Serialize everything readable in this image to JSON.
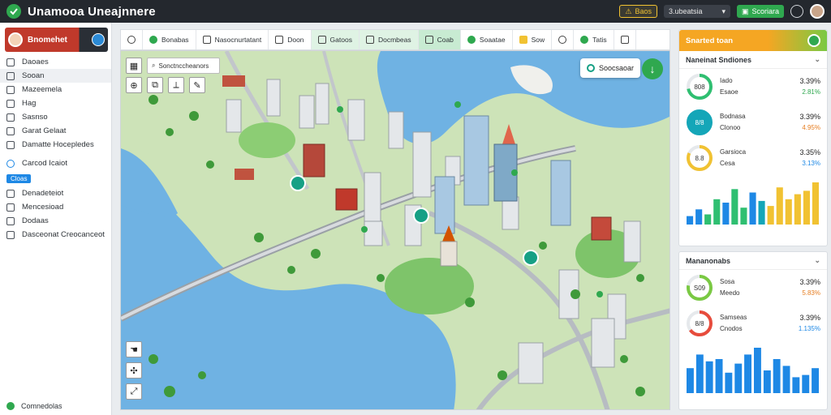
{
  "titlebar": {
    "app_title": "Unamooa Uneajnnere",
    "warn_chip": "Baos",
    "dropdown_label": "3.ubeatsia",
    "action_label": "Scoriara"
  },
  "sidebar": {
    "header_label": "Bnomehet",
    "items": [
      {
        "label": "Daoaes",
        "icon": "folder-icon"
      },
      {
        "label": "Sooan",
        "icon": "layers-icon",
        "active": true
      },
      {
        "label": "Mazeemela",
        "icon": "mail-icon"
      },
      {
        "label": "Hag",
        "icon": "map-icon"
      },
      {
        "label": "Sasnso",
        "icon": "list-icon"
      },
      {
        "label": "Garat Gelaat",
        "icon": "chart-icon"
      },
      {
        "label": "Damatte Hocepledes",
        "icon": "calendar-icon"
      }
    ],
    "section_item": {
      "label": "Carcod Icaiot",
      "icon": "target-icon"
    },
    "tag_label": "Cloas",
    "items2": [
      {
        "label": "Denadeteiot",
        "icon": "document-icon"
      },
      {
        "label": "Mencesioad",
        "icon": "message-icon"
      },
      {
        "label": "Dodaas",
        "icon": "grid-icon"
      },
      {
        "label": "Dasceonat Creocanceot",
        "icon": "settings-icon"
      }
    ],
    "footer_label": "Comnedolas"
  },
  "tabs": [
    {
      "label": "Bonabas",
      "icon": "globe-icon"
    },
    {
      "label": "Nasocnurtatant",
      "icon": "nodes-icon"
    },
    {
      "label": "Doon",
      "icon": "image-icon"
    },
    {
      "label": "Gatoos",
      "icon": "pin-icon",
      "hl": true
    },
    {
      "label": "Docmbeas",
      "icon": "route-icon",
      "hl": true
    },
    {
      "label": "Coab",
      "icon": "layers-icon",
      "hl2": true
    },
    {
      "label": "Soaatae",
      "icon": "circle-icon"
    },
    {
      "label": "Sow",
      "icon": "star-icon"
    },
    {
      "label": "",
      "icon": "shield-icon"
    },
    {
      "label": "Tatis",
      "icon": "leaf-icon"
    },
    {
      "label": "",
      "icon": "box-icon"
    }
  ],
  "map": {
    "search_text": "Sonctnccheanors",
    "pill_label": "Soocsaoar"
  },
  "rpanel": {
    "header_label": "Snarted toan",
    "card1": {
      "title": "Naneinat Sndiones",
      "metrics": [
        {
          "ring_label": "808",
          "name": "Iado",
          "sub": "Esaoe",
          "value": "3.39%",
          "delta": "2.81%",
          "ring_color": "#2fbf71",
          "ring_pct": 72,
          "delta_color": "up"
        },
        {
          "ring_label": "8/8",
          "name": "Bodnasa",
          "sub": "Clonoo",
          "value": "3.39%",
          "delta": "4.95%",
          "ring_color": "#14a6b8",
          "ring_pct": 100,
          "delta_color": "neg"
        },
        {
          "ring_label": "8.8",
          "name": "Garsioca",
          "sub": "Cesa",
          "value": "3.35%",
          "delta": "3.13%",
          "ring_color": "#f1c232",
          "ring_pct": 82,
          "delta_color": "blue"
        }
      ],
      "bar_values": [
        10,
        18,
        12,
        30,
        26,
        42,
        20,
        38,
        28,
        22,
        44,
        30,
        36,
        40,
        50
      ],
      "bar_colors": [
        "#1e88e5",
        "#1e88e5",
        "#2fbf71",
        "#2fbf71",
        "#1e88e5",
        "#2fbf71",
        "#2fbf71",
        "#1e88e5",
        "#14a6b8",
        "#f1c232",
        "#f1c232",
        "#f1c232",
        "#f1c232",
        "#f1c232",
        "#f1c232"
      ]
    },
    "card2": {
      "title": "Mananonabs",
      "metrics": [
        {
          "ring_label": "S09",
          "name": "Sosa",
          "sub": "Meedo",
          "value": "3.39%",
          "delta": "5.83%",
          "ring_color": "#7ac943",
          "ring_pct": 78,
          "delta_color": "neg"
        },
        {
          "ring_label": "8/8",
          "name": "Samseas",
          "sub": "Cnodos",
          "value": "3.39%",
          "delta": "1.135%",
          "ring_color": "#e74c3c",
          "ring_pct": 65,
          "delta_color": "blue"
        }
      ],
      "bar_values": [
        22,
        34,
        28,
        30,
        18,
        26,
        34,
        40,
        20,
        30,
        24,
        14,
        16,
        22
      ],
      "bar_colors": [
        "#1e88e5",
        "#1e88e5",
        "#1e88e5",
        "#1e88e5",
        "#1e88e5",
        "#1e88e5",
        "#1e88e5",
        "#1e88e5",
        "#1e88e5",
        "#1e88e5",
        "#1e88e5",
        "#1e88e5",
        "#1e88e5",
        "#1e88e5"
      ]
    }
  }
}
